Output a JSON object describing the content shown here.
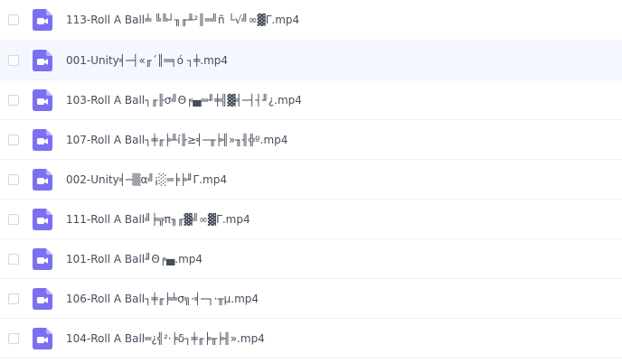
{
  "colors": {
    "icon_bg": "#7b6ff2",
    "icon_fold": "#b7afff",
    "row_hover_bg": "#f4f8fe",
    "divider": "#eef0f4",
    "text": "#454d5a"
  },
  "files": [
    {
      "name": "113-Roll A Ball╧ ╚╚┘╖╓╨²║═╝ñ └√╝∞▓Γ.mp4",
      "icon": "video-file-icon",
      "hovered": false
    },
    {
      "name": "001-Unity╡─┤«╓´║═╕ó ┐╪.mp4",
      "icon": "video-file-icon",
      "hovered": true
    },
    {
      "name": "103-Roll A Ball┐╓╟σ╝Θ╒▄═╜╪╣▓╡─┤┤╜¿.mp4",
      "icon": "video-file-icon",
      "hovered": false
    },
    {
      "name": "107-Roll A Ball┐╪╓╞╨í╟≥╡─╥╞╢»╖╢╬º.mp4",
      "icon": "video-file-icon",
      "hovered": false
    },
    {
      "name": "002-Unity╡─▒α╝¡░═╞╞╜Γ.mp4",
      "icon": "video-file-icon",
      "hovered": false
    },
    {
      "name": "111-Roll A Ball╝╞╦π╖╓▓╝∞▓Γ.mp4",
      "icon": "video-file-icon",
      "hovered": false
    },
    {
      "name": "101-Roll A Ball╜Θ╒▄.mp4",
      "icon": "video-file-icon",
      "hovered": false
    },
    {
      "name": "106-Roll A Ball┐╪╓╞╧σ╗·╡─┐·╥µ.mp4",
      "icon": "video-file-icon",
      "hovered": false
    },
    {
      "name": "104-Roll A Ball═¿╣²·╞δ┐╪╓╞╥╞╢».mp4",
      "icon": "video-file-icon",
      "hovered": false
    }
  ]
}
